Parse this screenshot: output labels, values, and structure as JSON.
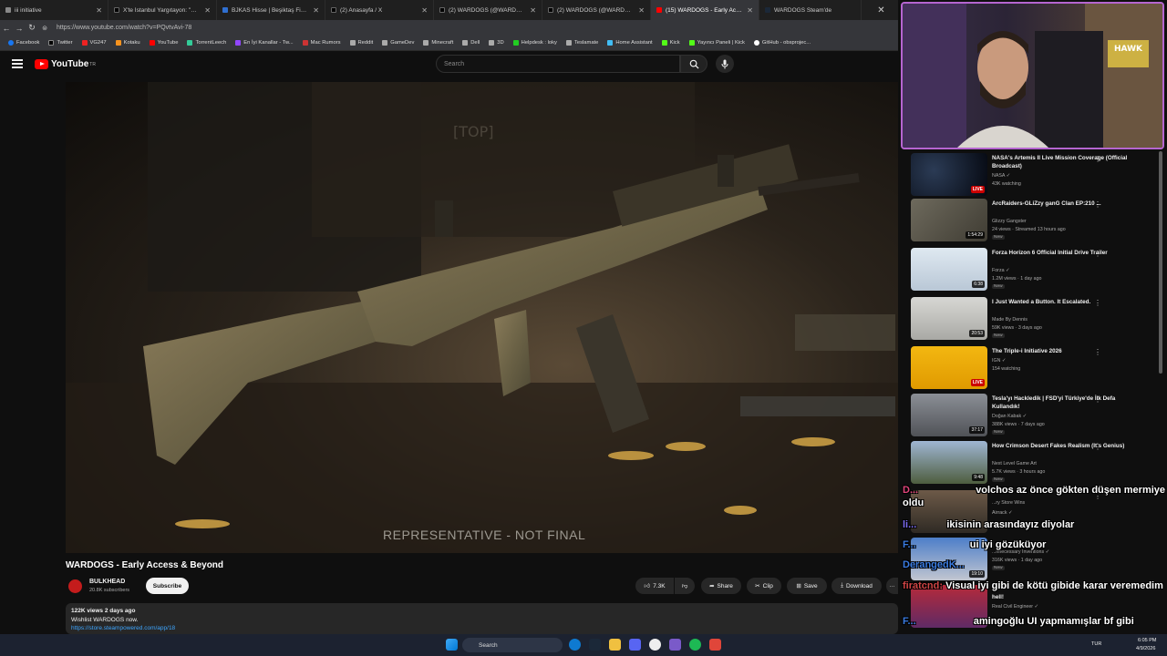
{
  "browser": {
    "tabs": [
      {
        "label": "iii initiative",
        "active": false
      },
      {
        "label": "X'te İstanbul Yargıtayon: \"CANLI BL",
        "active": false
      },
      {
        "label": "BJKAS Hisse | Beşiktaş Fiyatları - İn",
        "active": false
      },
      {
        "label": "(2) Anasayfa / X",
        "active": false
      },
      {
        "label": "(2) WARDOGS (@WARDOGS) / X",
        "active": false
      },
      {
        "label": "(2) WARDOGS (@WARDOGS) / X",
        "active": false
      },
      {
        "label": "(15) WARDOGS - Early Acces",
        "active": true
      },
      {
        "label": "WARDOGS Steam'de",
        "active": false
      }
    ],
    "close_window": "✕",
    "url": "https://www.youtube.com/watch?v=PQvtvAvi-78",
    "bookmarks": [
      "Facebook",
      "Twitter",
      "VG247",
      "Kotaku",
      "YouTube",
      "TorrentLeech",
      "En İyi Kanallar - Tw...",
      "Mac Rumors",
      "Reddit",
      "GameDev",
      "Minecraft",
      "Dell",
      "3D",
      "Helpdesk : loky",
      "Teslamate",
      "Home Assistant",
      "Kick",
      "Yayıncı Paneli | Kick",
      "GitHub - obsprojec..."
    ]
  },
  "youtube": {
    "logo": "YouTube",
    "region": "TR",
    "search_placeholder": "Search"
  },
  "video": {
    "overlay_caption": "REPRESENTATIVE - NOT FINAL",
    "title": "WARDOGS - Early Access & Beyond",
    "channel": "BULKHEAD",
    "subscribers": "20.8K subscribers",
    "subscribe_label": "Subscribe",
    "likes": "7.3K",
    "share_label": "Share",
    "clip_label": "Clip",
    "save_label": "Save",
    "download_label": "Download",
    "more_label": "···",
    "description": {
      "meta": "122K views  2 days ago",
      "line1": "Wishlist WARDOGS now.",
      "link": "https://store.steampowered.com/app/18"
    }
  },
  "recommendations": [
    {
      "title": "NASA's Artemis II Live Mission Coverage (Official Broadcast)",
      "channel": "NASA ✓",
      "meta": "43K watching",
      "badge": "",
      "duration": "",
      "live": "LIVE"
    },
    {
      "title": "ArcRaiders-GLiZzy ganG Clan EP:210 ...",
      "channel": "Glizzy Gangster",
      "meta": "24 views · Streamed 13 hours ago",
      "badge": "New",
      "duration": "1:54:29",
      "live": ""
    },
    {
      "title": "Forza Horizon 6 Official Initial Drive Trailer",
      "channel": "Forza ✓",
      "meta": "1.2M views · 1 day ago",
      "badge": "New",
      "duration": "6:38",
      "live": ""
    },
    {
      "title": "I Just Wanted a Button. It Escalated.",
      "channel": "Made By Dennis",
      "meta": "59K views · 3 days ago",
      "badge": "New",
      "duration": "20:53",
      "live": ""
    },
    {
      "title": "The Triple-i Initiative 2026",
      "channel": "IGN ✓",
      "meta": "154 watching",
      "badge": "",
      "duration": "",
      "live": "LIVE"
    },
    {
      "title": "Tesla'yı Hackledik | FSD'yi Türkiye'de İlk Defa Kullandık!",
      "channel": "Doğan Kabak ✓",
      "meta": "388K views · 7 days ago",
      "badge": "New",
      "duration": "37:17",
      "live": ""
    },
    {
      "title": "How Crimson Desert Fakes Realism (It's Genius)",
      "channel": "Next Level Game Art",
      "meta": "5.7K views · 3 hours ago",
      "badge": "New",
      "duration": "9:48",
      "live": ""
    }
  ],
  "recommendations_partial": {
    "r8_channel": "Airrack ✓",
    "r8_meta": "...ry Store Wins",
    "r9_channel": "...nnecessary Inventions ✓",
    "r9_meta": "316K views · 1 day ago",
    "r9_badge": "New",
    "r9_duration": "19:10",
    "r10_title": "hell!",
    "r10_channel": "Real Civil Engineer ✓"
  },
  "chat_overlay": [
    {
      "user": "D...",
      "text": "volchos az önce gökten düşen mermiye oldu"
    },
    {
      "user": "li...",
      "text": "ikisinin arasındayız diyolar"
    },
    {
      "user": "F...",
      "text": "ui iyi gözüküyor"
    },
    {
      "user": "DerangedK...",
      "text": ""
    },
    {
      "user": "firatcnd:",
      "text": "Visual iyi gibi de kötü gibide karar veremedim"
    },
    {
      "user": "F...",
      "text": "amingoğlu UI yapmamışlar bf gibi"
    }
  ],
  "taskbar": {
    "search_label": "Search",
    "lang": "TUR",
    "time": "6:05 PM",
    "date": "4/9/2026"
  }
}
